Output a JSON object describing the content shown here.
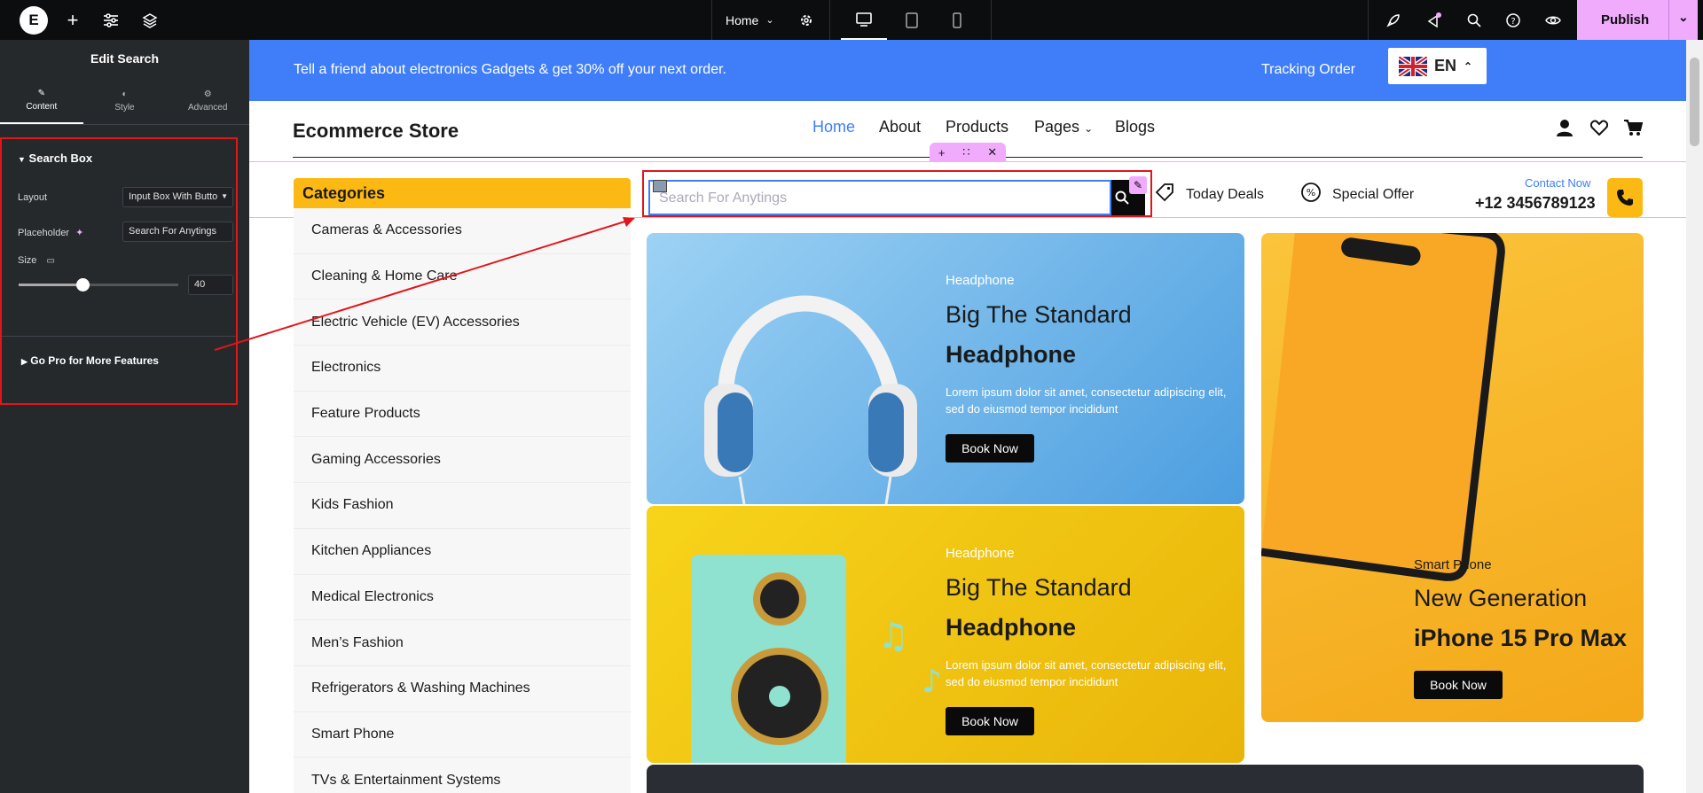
{
  "editor": {
    "page_selector": "Home",
    "publish_label": "Publish",
    "panel_title": "Edit Search",
    "tabs": [
      {
        "label": "Content",
        "icon": "pencil-icon"
      },
      {
        "label": "Style",
        "icon": "half-circle-icon"
      },
      {
        "label": "Advanced",
        "icon": "gear-icon"
      }
    ],
    "section_title": "Search Box",
    "layout_label": "Layout",
    "layout_value": "Input Box With Butto",
    "placeholder_label": "Placeholder",
    "placeholder_value": "Search For Anytings",
    "size_label": "Size",
    "size_value": "40",
    "size_level": 0.4,
    "gopro_label": "Go Pro for More Features",
    "colors": {
      "accent": "#f0abfc",
      "highlight": "#e0161b"
    }
  },
  "site": {
    "promo_text": "Tell a friend about electronics Gadgets & get 30% off your next order.",
    "tracking_label": "Tracking Order",
    "lang_label": "EN",
    "brand": "Ecommerce Store",
    "nav": [
      "Home",
      "About",
      "Products",
      "Pages",
      "Blogs"
    ],
    "categories_title": "Categories",
    "categories": [
      "Cameras & Accessories",
      "Cleaning & Home Care",
      "Electric Vehicle (EV) Accessories",
      "Electronics",
      "Feature Products",
      "Gaming Accessories",
      "Kids Fashion",
      "Kitchen Appliances",
      "Medical Electronics",
      "Men’s Fashion",
      "Refrigerators & Washing Machines",
      "Smart Phone",
      "TVs & Entertainment Systems"
    ],
    "search_placeholder": "Search For Anytings",
    "deals": [
      "Today Deals",
      "Special Offer"
    ],
    "contact_label": "Contact Now",
    "contact_phone": "+12 3456789123",
    "banners": [
      {
        "eyebrow": "Headphone",
        "title1": "Big The Standard",
        "title2": "Headphone",
        "text": "Lorem ipsum dolor sit amet, consectetur adipiscing elit, sed do eiusmod tempor incididunt",
        "button": "Book Now"
      },
      {
        "eyebrow": "Headphone",
        "title1": "Big The Standard",
        "title2": "Headphone",
        "text": "Lorem ipsum dolor sit amet, consectetur adipiscing elit, sed do eiusmod tempor incididunt",
        "button": "Book Now"
      },
      {
        "eyebrow": "Smart Phone",
        "title1": "New Generation",
        "title2": "iPhone 15 Pro Max",
        "button": "Book Now"
      }
    ],
    "colors": {
      "promo": "#3f7ef8",
      "category_header": "#fdb913",
      "nav_active": "#3f7ef8"
    }
  }
}
